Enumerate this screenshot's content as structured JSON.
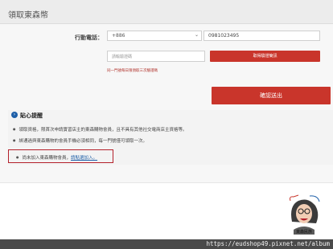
{
  "header": {
    "title": "領取東森幣"
  },
  "form": {
    "phone_label": "行動電話：",
    "country_code": "+886",
    "phone_value": "0981023495",
    "code_placeholder": "請輸驗證碼",
    "get_code_label": "取得驗證簡訊",
    "limit_note": "同一門號每日限領取三次驗證碼",
    "confirm_label": "確認送出"
  },
  "notice": {
    "title": "貼心提醒",
    "items": [
      "領取資格，限首次申請實習店主的東森購物會員，且不具有其他社交電商店主資格等。",
      "綁通過與東森購物的會員手機必須相同，每一門號僅可領取一次。"
    ],
    "unjoined_text": "尚未加入東森購物會員，",
    "join_link": "請點選加入。"
  },
  "colors": {
    "accent_red": "#c9352b",
    "link_blue": "#1e5fa8",
    "frame_red": "#b4212b"
  },
  "icons": {
    "notice": "info-circle-icon",
    "select": "chevron-down-icon"
  },
  "watermark": {
    "sticker_caption": "東森民族",
    "url": "https://eudshop49.pixnet.net/album"
  }
}
